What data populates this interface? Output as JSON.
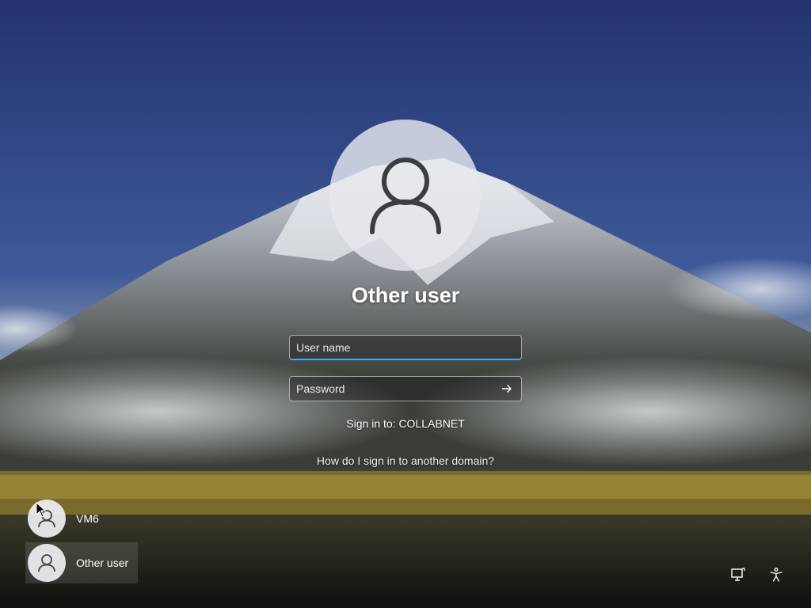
{
  "login": {
    "selected_user": "Other user",
    "username_placeholder": "User name",
    "password_placeholder": "Password",
    "sign_in_to": "Sign in to: COLLABNET",
    "domain_help_link": "How do I sign in to another domain?"
  },
  "users": [
    {
      "name": "VM6"
    },
    {
      "name": "Other user"
    }
  ],
  "icons": {
    "avatar": "person-icon",
    "submit": "arrow-right-icon",
    "network": "network-icon",
    "accessibility": "accessibility-icon"
  }
}
